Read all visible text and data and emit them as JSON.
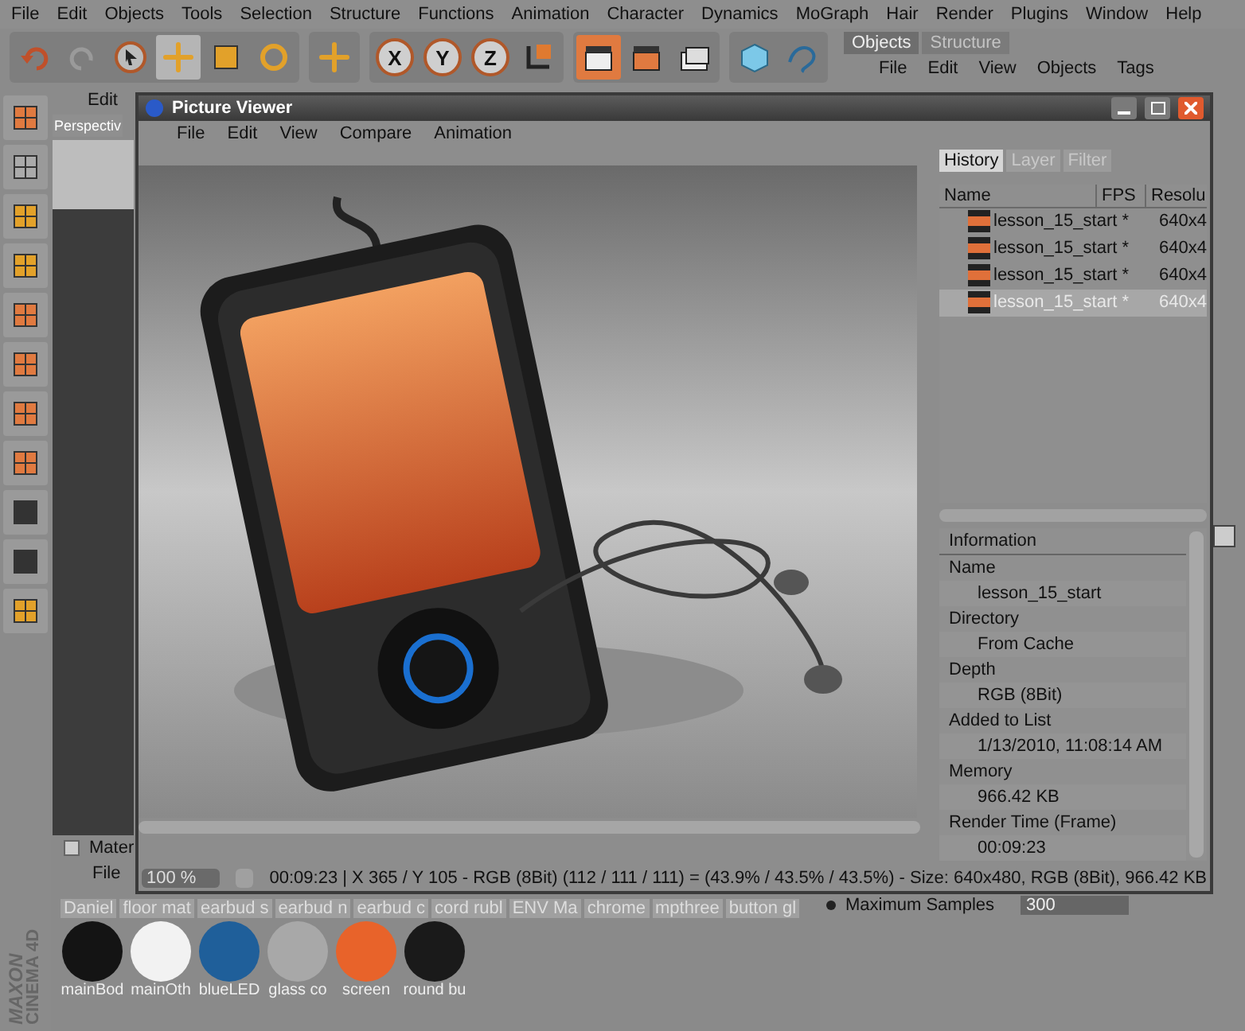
{
  "menu": [
    "File",
    "Edit",
    "Objects",
    "Tools",
    "Selection",
    "Structure",
    "Functions",
    "Animation",
    "Character",
    "Dynamics",
    "MoGraph",
    "Hair",
    "Render",
    "Plugins",
    "Window",
    "Help"
  ],
  "axis_buttons": [
    "X",
    "Y",
    "Z"
  ],
  "objects_panel": {
    "tabs": [
      {
        "label": "Objects",
        "selected": true
      },
      {
        "label": "Structure",
        "selected": false
      }
    ],
    "menu": [
      "File",
      "Edit",
      "View",
      "Objects",
      "Tags"
    ]
  },
  "viewport": {
    "menu": "Edit",
    "tab": "Perspectiv"
  },
  "picture_viewer": {
    "title": "Picture Viewer",
    "menu": [
      "File",
      "Edit",
      "View",
      "Compare",
      "Animation"
    ],
    "tabs": [
      {
        "label": "History",
        "selected": true
      },
      {
        "label": "Layer",
        "selected": false
      },
      {
        "label": "Filter",
        "selected": false
      }
    ],
    "columns": [
      "Name",
      "FPS",
      "Resolu"
    ],
    "rows": [
      {
        "name": "lesson_15_start *",
        "resolution": "640x4",
        "selected": false
      },
      {
        "name": "lesson_15_start *",
        "resolution": "640x4",
        "selected": false
      },
      {
        "name": "lesson_15_start *",
        "resolution": "640x4",
        "selected": false
      },
      {
        "name": "lesson_15_start *",
        "resolution": "640x4",
        "selected": true
      }
    ],
    "info_title": "Information",
    "info": [
      {
        "label": "Name",
        "value": "lesson_15_start"
      },
      {
        "label": "Directory",
        "value": "From Cache"
      },
      {
        "label": "Depth",
        "value": "RGB (8Bit)"
      },
      {
        "label": "Added to List",
        "value": "1/13/2010, 11:08:14 AM"
      },
      {
        "label": "Memory",
        "value": "966.42 KB"
      },
      {
        "label": "Render Time (Frame)",
        "value": "00:09:23"
      }
    ],
    "zoom": "100 %",
    "status": "00:09:23 | X 365 / Y 105 - RGB (8Bit) (112 / 111 / 111) = (43.9% / 43.5% / 43.5%) - Size: 640x480, RGB (8Bit), 966.42 KB"
  },
  "materials": {
    "checked": false,
    "title": "Mater",
    "menu": "File",
    "labels": [
      "Daniel",
      "floor mat",
      "earbud s",
      "earbud n",
      "earbud c",
      "cord rubl",
      "ENV Ma",
      "chrome",
      "mpthree",
      "button gl"
    ],
    "items": [
      {
        "name": "mainBod",
        "color": "#141414"
      },
      {
        "name": "mainOth",
        "color": "#f2f2f2"
      },
      {
        "name": "blueLED",
        "color": "#1f5f9a"
      },
      {
        "name": "glass co",
        "color": "#a8a8a8"
      },
      {
        "name": "screen",
        "color": "#e8632a"
      },
      {
        "name": "round bu",
        "color": "#1a1a1a"
      }
    ]
  },
  "attributes": {
    "label": "Maximum Samples",
    "value": "300"
  },
  "logo": {
    "brand": "MAXON",
    "product": "CINEMA 4D"
  }
}
